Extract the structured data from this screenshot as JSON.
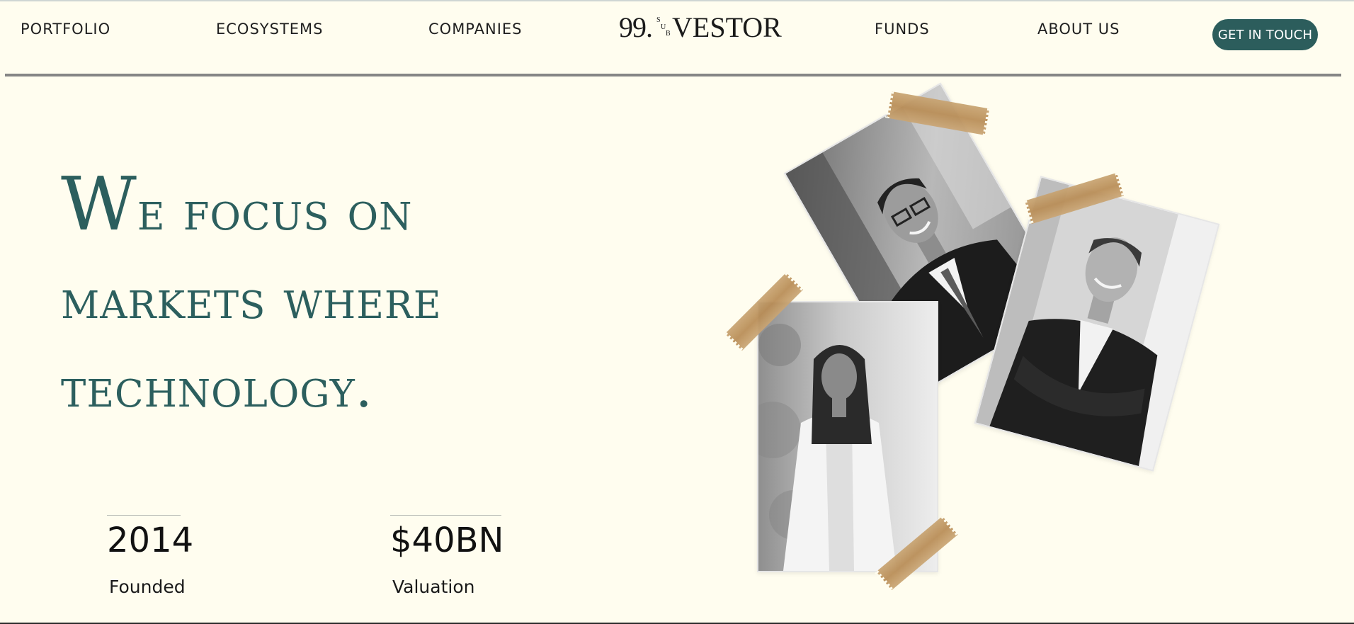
{
  "nav": {
    "items": [
      {
        "label": "PORTFOLIO"
      },
      {
        "label": "ECOSYSTEMS"
      },
      {
        "label": "COMPANIES"
      },
      {
        "label": "FUNDS"
      },
      {
        "label": "ABOUT US"
      }
    ],
    "cta_label": "GET IN TOUCH"
  },
  "logo": {
    "number": "99.",
    "sub_letters": [
      "S",
      "U",
      "B"
    ],
    "word": "VESTOR"
  },
  "hero": {
    "title_lines": [
      "We focus on",
      "markets where",
      "technology."
    ]
  },
  "stats": [
    {
      "value": "2014",
      "label": "Founded"
    },
    {
      "value": "$40BN",
      "label": "Valuation"
    }
  ],
  "photos": [
    {
      "alt": "man-in-suit-with-glasses"
    },
    {
      "alt": "man-with-crossed-arms"
    },
    {
      "alt": "woman-in-white-blazer"
    }
  ],
  "colors": {
    "background": "#fffdef",
    "accent": "#2c5d5c",
    "title": "#2c5f5e",
    "tape": "#c09a63"
  }
}
